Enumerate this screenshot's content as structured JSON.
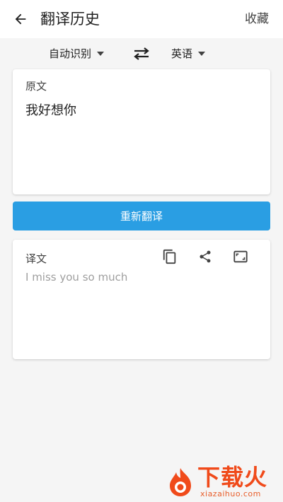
{
  "header": {
    "title": "翻译历史",
    "favorites_label": "收藏"
  },
  "languages": {
    "source": "自动识别",
    "target": "英语"
  },
  "source_card": {
    "label": "原文",
    "text": "我好想你"
  },
  "retranslate_label": "重新翻译",
  "target_card": {
    "label": "译文",
    "text": "I miss you so much",
    "actions": [
      "copy-icon",
      "share-icon",
      "fullscreen-icon"
    ]
  },
  "watermark": {
    "brand": "下载火",
    "url": "xiazaihuo.com"
  },
  "colors": {
    "accent": "#2a9ee3",
    "background": "#f5f5f5",
    "watermark": "#f04a1a"
  }
}
